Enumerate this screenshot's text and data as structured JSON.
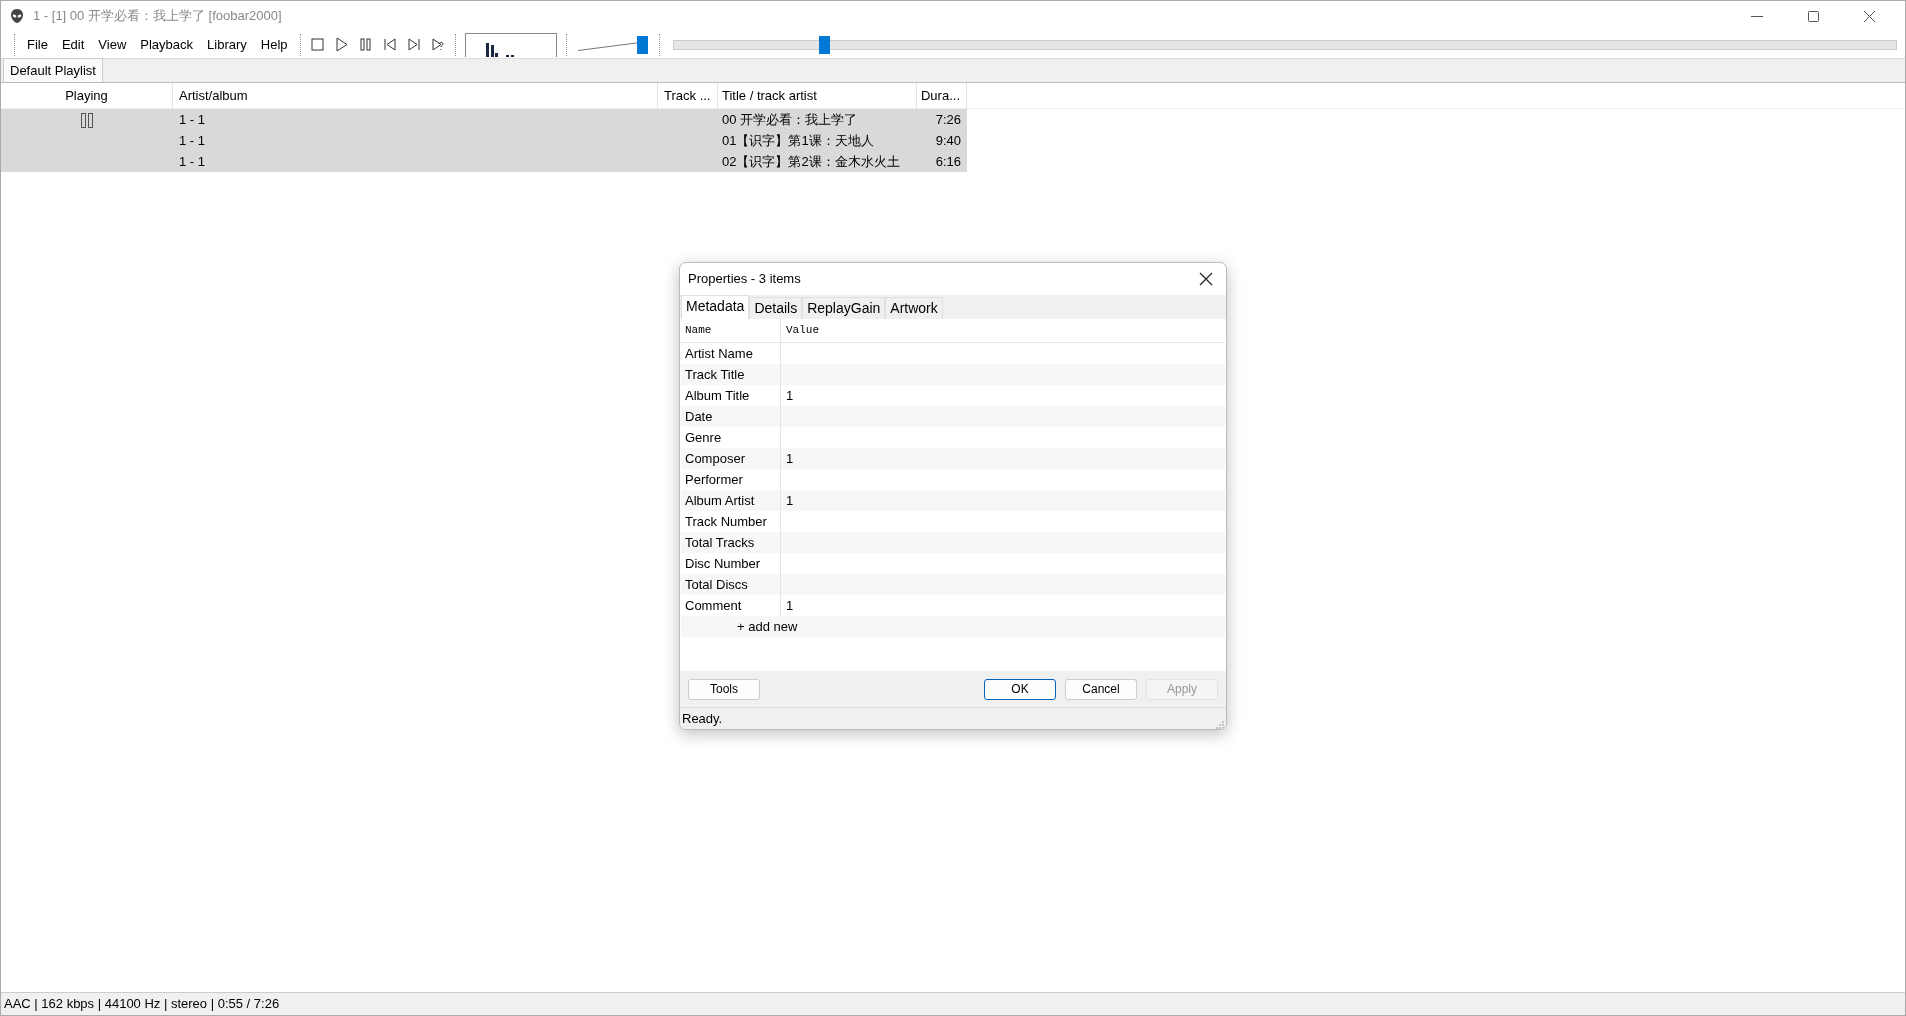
{
  "window": {
    "title": "1 - [1] 00 开学必看：我上学了  [foobar2000]"
  },
  "menu": [
    "File",
    "Edit",
    "View",
    "Playback",
    "Library",
    "Help"
  ],
  "transport": [
    {
      "kind": "stop"
    },
    {
      "kind": "play"
    },
    {
      "kind": "pause"
    },
    {
      "kind": "prev"
    },
    {
      "kind": "next"
    },
    {
      "kind": "random"
    }
  ],
  "volume": {
    "level": 0.92
  },
  "seek": {
    "level": 0.123
  },
  "playlist_tabs": [
    {
      "label": "Default Playlist",
      "selected": true
    }
  ],
  "playlist": {
    "columns": [
      "Playing",
      "Artist/album",
      "Track ...",
      "Title / track artist",
      "Dura..."
    ],
    "rows": [
      {
        "playing": true,
        "artist_album": "1 - 1",
        "title": "00 开学必看：我上学了",
        "duration": "7:26",
        "selected": true
      },
      {
        "playing": false,
        "artist_album": "1 - 1",
        "title": "01【识字】第1课：天地人",
        "duration": "9:40",
        "selected": true
      },
      {
        "playing": false,
        "artist_album": "1 - 1",
        "title": "02【识字】第2课：金木水火土",
        "duration": "6:16",
        "selected": true
      }
    ]
  },
  "dialog": {
    "title": "Properties - 3 items",
    "tabs": [
      {
        "label": "Metadata",
        "selected": true
      },
      {
        "label": "Details",
        "selected": false
      },
      {
        "label": "ReplayGain",
        "selected": false
      },
      {
        "label": "Artwork",
        "selected": false
      }
    ],
    "columns": [
      "Name",
      "Value"
    ],
    "fields": [
      {
        "name": "Artist Name"
      },
      {
        "name": "Track Title"
      },
      {
        "name": "Album Title",
        "value": "1"
      },
      {
        "name": "Date"
      },
      {
        "name": "Genre"
      },
      {
        "name": "Composer",
        "value": "1"
      },
      {
        "name": "Performer"
      },
      {
        "name": "Album Artist",
        "value": "1"
      },
      {
        "name": "Track Number"
      },
      {
        "name": "Total Tracks"
      },
      {
        "name": "Disc Number"
      },
      {
        "name": "Total Discs"
      },
      {
        "name": "Comment",
        "value": "1"
      }
    ],
    "add_new": "+ add new",
    "buttons": [
      {
        "label": "Tools",
        "kind": "left",
        "disabled": false,
        "default": false
      },
      {
        "label": "OK",
        "kind": "right",
        "disabled": false,
        "default": true
      },
      {
        "label": "Cancel",
        "kind": "right",
        "disabled": false,
        "default": false
      },
      {
        "label": "Apply",
        "kind": "right",
        "disabled": true,
        "default": false
      }
    ],
    "status": "Ready."
  },
  "status_bar": "AAC | 162 kbps | 44100 Hz | stereo | 0:55 / 7:26"
}
